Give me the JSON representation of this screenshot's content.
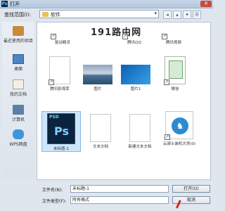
{
  "window": {
    "title": "打开",
    "close_glyph": "✕"
  },
  "lookin": {
    "label": "查找范围(I):",
    "value": "软件"
  },
  "watermark": "191路由网",
  "places": [
    {
      "label": "最近使用的项目"
    },
    {
      "label": "桌面"
    },
    {
      "label": "我的文档"
    },
    {
      "label": "计算机"
    },
    {
      "label": "WPS网盘"
    }
  ],
  "files": [
    {
      "name": "驱动精灵"
    },
    {
      "name": "腾讯QQ"
    },
    {
      "name": "腾讯视频"
    },
    {
      "name": "腾讯影视库"
    },
    {
      "name": "图片"
    },
    {
      "name": "图片1"
    },
    {
      "name": "微信"
    },
    {
      "name": "未标题-1"
    },
    {
      "name": "文本文档"
    },
    {
      "name": "新建文本文档"
    },
    {
      "name": "云骑士装机大师(0)"
    }
  ],
  "bottom": {
    "filename_label": "文件名(N):",
    "filename_value": "未标题-1",
    "filetype_label": "文件类型(F):",
    "filetype_value": "所有格式",
    "open_label": "打开(O)",
    "cancel_label": "取消"
  },
  "colors": {
    "titlebar": "#b3c6dc",
    "close_button": "#c94b3f",
    "selection": "#cde6fb",
    "pointer": "#dd2222"
  }
}
